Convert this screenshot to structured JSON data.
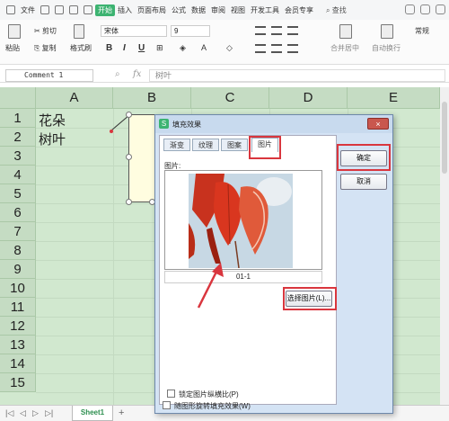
{
  "menubar": {
    "file": "文件",
    "tabs": [
      "开始",
      "插入",
      "页面布局",
      "公式",
      "数据",
      "审阅",
      "视图",
      "开发工具",
      "会员专享"
    ],
    "search": "查找"
  },
  "ribbon": {
    "paste": "粘贴",
    "cut": "剪切",
    "copy": "复制",
    "format_painter": "格式刷",
    "font_name": "宋体",
    "font_size": "9",
    "bold": "B",
    "italic": "I",
    "underline": "U",
    "merge_center": "合并居中",
    "wrap_text": "自动换行",
    "number_format": "常规"
  },
  "formula_bar": {
    "name_box": "Comment 1",
    "content": "树叶"
  },
  "sheet": {
    "columns": [
      "A",
      "B",
      "C",
      "D",
      "E"
    ],
    "rows": [
      "1",
      "2",
      "3",
      "4",
      "5",
      "6",
      "7",
      "8",
      "9",
      "10",
      "11",
      "12",
      "13",
      "14",
      "15"
    ],
    "cells": {
      "A1": "花朵",
      "A2": "树叶"
    }
  },
  "sheet_tabs": {
    "active": "Sheet1",
    "add": "+"
  },
  "dialog": {
    "title": "填充效果",
    "close": "×",
    "tabs": [
      "渐变",
      "纹理",
      "图案",
      "图片"
    ],
    "picture_label": "图片:",
    "image_name": "01-1",
    "select_picture_button": "选择图片(L)...",
    "lock_aspect": "锁定图片纵横比(P)",
    "rotate_with_shape": "随图形旋转填充效果(W)",
    "ok": "确定",
    "cancel": "取消"
  },
  "colors": {
    "accent_green": "#3cb371",
    "highlight_red": "#d9363e",
    "sheet_bg": "#d1e8cf"
  }
}
